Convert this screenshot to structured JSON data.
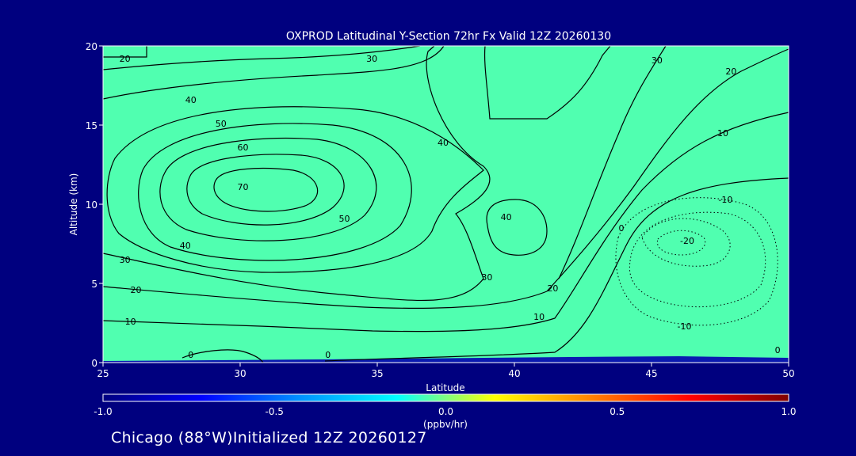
{
  "chart_data": {
    "type": "contour",
    "title": "OXPROD Latitudinal Y-Section 72hr  Fx Valid 12Z 20260130",
    "xlabel": "Latitude",
    "ylabel": "Altitude (km)",
    "xlim": [
      25,
      50
    ],
    "ylim": [
      0,
      20
    ],
    "x_ticks": [
      "25",
      "30",
      "35",
      "40",
      "45",
      "50"
    ],
    "y_ticks": [
      "0",
      "5",
      "10",
      "15",
      "20"
    ],
    "background_fill_color": "#50ffb0",
    "contour_color": "#000000",
    "negative_contours": "dotted",
    "contour_labels": [
      "20",
      "30",
      "40",
      "50",
      "60",
      "70",
      "40",
      "50",
      "40",
      "30",
      "20",
      "10",
      "0",
      "0",
      "40",
      "30",
      "20",
      "10",
      "0",
      "30",
      "20",
      "10",
      "-10",
      "-20",
      "-10",
      "0"
    ],
    "contour_label_points": [
      {
        "label": "20",
        "x": 25.8,
        "y": 19.0
      },
      {
        "label": "30",
        "x": 34.8,
        "y": 19.0
      },
      {
        "label": "40",
        "x": 28.2,
        "y": 16.4
      },
      {
        "label": "50",
        "x": 29.3,
        "y": 14.9
      },
      {
        "label": "60",
        "x": 30.1,
        "y": 13.4
      },
      {
        "label": "70",
        "x": 30.1,
        "y": 10.9
      },
      {
        "label": "40",
        "x": 37.4,
        "y": 13.7
      },
      {
        "label": "50",
        "x": 33.8,
        "y": 8.9
      },
      {
        "label": "40",
        "x": 28.0,
        "y": 7.2
      },
      {
        "label": "30",
        "x": 25.8,
        "y": 6.3
      },
      {
        "label": "20",
        "x": 26.2,
        "y": 4.4
      },
      {
        "label": "10",
        "x": 26.0,
        "y": 2.4
      },
      {
        "label": "0",
        "x": 28.2,
        "y": 0.3
      },
      {
        "label": "0",
        "x": 33.2,
        "y": 0.3
      },
      {
        "label": "40",
        "x": 39.7,
        "y": 9.0
      },
      {
        "label": "30",
        "x": 39.0,
        "y": 5.2
      },
      {
        "label": "20",
        "x": 41.4,
        "y": 4.5
      },
      {
        "label": "10",
        "x": 40.9,
        "y": 2.7
      },
      {
        "label": "0",
        "x": 43.9,
        "y": 8.3
      },
      {
        "label": "30",
        "x": 45.2,
        "y": 18.9
      },
      {
        "label": "20",
        "x": 47.9,
        "y": 18.2
      },
      {
        "label": "10",
        "x": 47.6,
        "y": 14.3
      },
      {
        "label": "-10",
        "x": 47.7,
        "y": 10.1
      },
      {
        "label": "-20",
        "x": 46.3,
        "y": 7.5
      },
      {
        "label": "-10",
        "x": 46.2,
        "y": 2.1
      },
      {
        "label": "0",
        "x": 49.6,
        "y": 0.6
      }
    ],
    "colorbar": {
      "ticks": [
        "-1.0",
        "-0.5",
        "0.0",
        "0.5",
        "1.0"
      ],
      "unit": "(ppbv/hr)",
      "colors": [
        "#00007f",
        "#0000ff",
        "#0090ff",
        "#00ffff",
        "#ffff00",
        "#ff8000",
        "#ff0000",
        "#7f0000"
      ]
    }
  },
  "footer_text": "Chicago (88°W)Initialized 12Z 20260127"
}
